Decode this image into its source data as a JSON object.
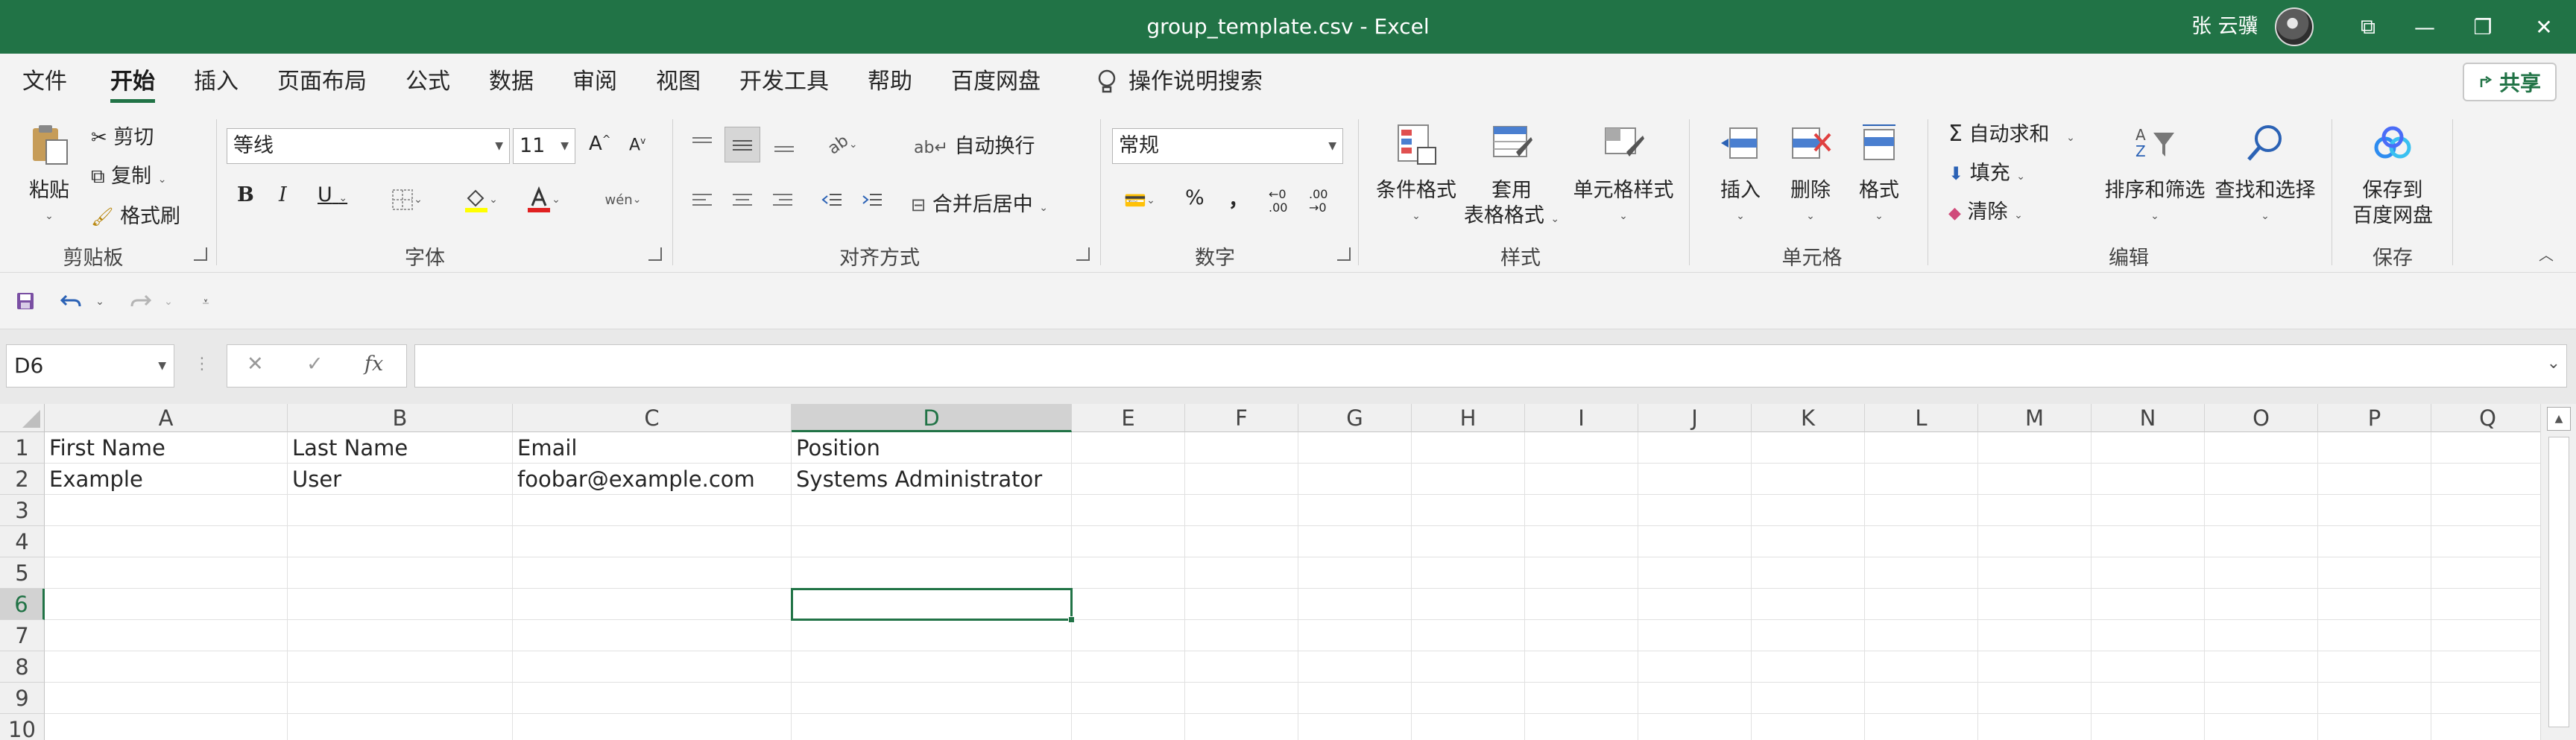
{
  "window": {
    "title": "group_template.csv  -  Excel",
    "user": "张 云骥",
    "controls": [
      "⧉",
      "—",
      "❐",
      "✕"
    ]
  },
  "menu": {
    "tabs": [
      "文件",
      "开始",
      "插入",
      "页面布局",
      "公式",
      "数据",
      "审阅",
      "视图",
      "开发工具",
      "帮助",
      "百度网盘"
    ],
    "active": "开始",
    "tell_me": "操作说明搜索",
    "share": "共享"
  },
  "ribbon": {
    "clipboard": {
      "paste": "粘贴",
      "cut": "剪切",
      "copy": "复制",
      "format_painter": "格式刷",
      "label": "剪贴板"
    },
    "font": {
      "name": "等线",
      "size": "11",
      "grow": "A",
      "shrink": "A",
      "bold": "B",
      "italic": "I",
      "underline": "U",
      "label": "字体"
    },
    "alignment": {
      "wrap": "自动换行",
      "merge": "合并后居中",
      "label": "对齐方式"
    },
    "number": {
      "format": "常规",
      "percent": "%",
      "comma": "，",
      "inc_decimal": "←0 .00",
      "dec_decimal": ".00 →0",
      "label": "数字"
    },
    "styles": {
      "conditional": "条件格式",
      "table_line1": "套用",
      "table_line2": "表格格式",
      "cell_styles": "单元格样式",
      "label": "样式"
    },
    "cells": {
      "insert": "插入",
      "delete": "删除",
      "format": "格式",
      "label": "单元格"
    },
    "editing": {
      "autosum": "自动求和",
      "fill": "填充",
      "clear": "清除",
      "sort": "排序和筛选",
      "find": "查找和选择",
      "label": "编辑"
    },
    "save": {
      "line1": "保存到",
      "line2": "百度网盘",
      "label": "保存"
    }
  },
  "formula_bar": {
    "name_box": "D6",
    "cancel": "✕",
    "enter": "✓",
    "fx": "fx",
    "content": ""
  },
  "sheet": {
    "columns": [
      "A",
      "B",
      "C",
      "D",
      "E",
      "F",
      "G",
      "H",
      "I",
      "J",
      "K",
      "L",
      "M",
      "N",
      "O",
      "P",
      "Q"
    ],
    "rows": [
      "1",
      "2",
      "3",
      "4",
      "5",
      "6",
      "7",
      "8",
      "9",
      "10"
    ],
    "cells": [
      [
        "First Name",
        "Last Name",
        "Email",
        "Position"
      ],
      [
        "Example",
        "User",
        "foobar@example.com",
        "Systems Administrator"
      ]
    ],
    "selected_cell": "D6"
  },
  "colors": {
    "accent": "#217346",
    "ribbon_bg": "#f3f3f3"
  }
}
